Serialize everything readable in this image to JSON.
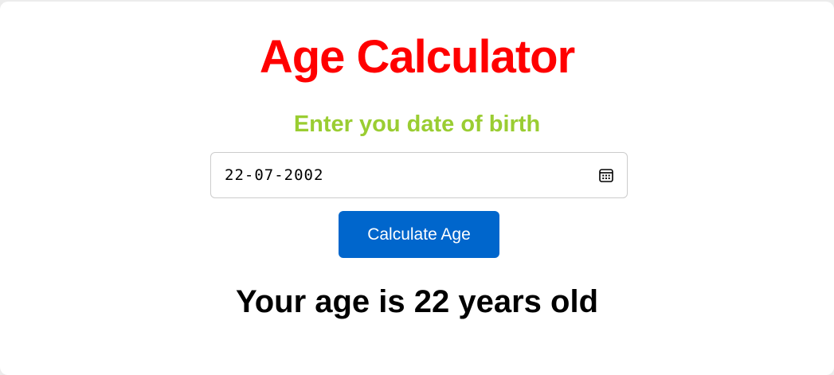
{
  "app": {
    "title": "Age Calculator",
    "subtitle": "Enter you date of birth"
  },
  "form": {
    "date_value": "22-07-2002",
    "calendar_icon": "calendar-icon",
    "button_label": "Calculate Age"
  },
  "result": {
    "text": "Your age is 22 years old"
  },
  "colors": {
    "title": "#ff0000",
    "subtitle": "#9acd32",
    "button_bg": "#0066cc",
    "button_text": "#ffffff",
    "result": "#000000"
  }
}
